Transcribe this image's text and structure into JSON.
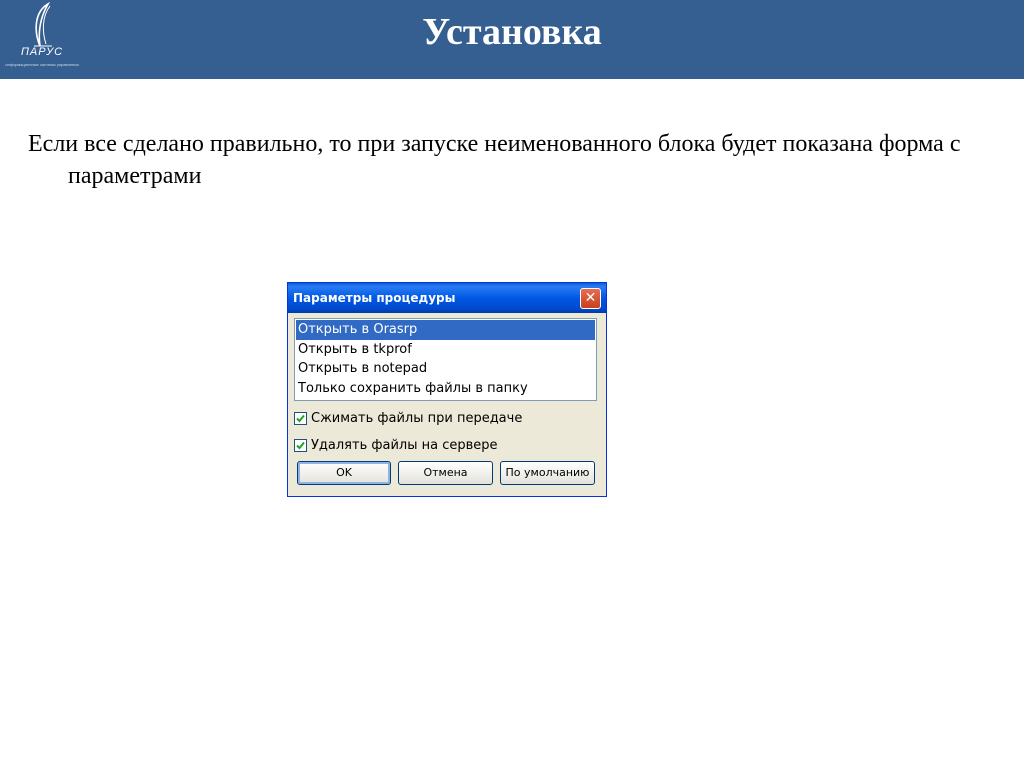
{
  "header": {
    "title": "Установка",
    "logo": {
      "word": "ПАРУС",
      "tagline": "информационные системы управления"
    }
  },
  "body": {
    "text": "Если все сделано правильно, то при запуске неименованного блока будет показана форма с параметрами"
  },
  "dialog": {
    "title": "Параметры процедуры",
    "close_glyph": "✕",
    "list": {
      "items": [
        "Открыть в Orasrp",
        "Открыть в tkprof",
        "Открыть в notepad",
        "Только сохранить файлы в папку"
      ],
      "selected_index": 0
    },
    "checkboxes": {
      "compress": {
        "label": "Сжимать файлы при передаче",
        "checked": true
      },
      "delete": {
        "label": "Удалять файлы на сервере",
        "checked": true
      }
    },
    "buttons": {
      "ok": "OK",
      "cancel": "Отмена",
      "defaults": "По умолчанию"
    }
  },
  "colors": {
    "header_bg": "#365f91",
    "dialog_bg": "#ece9d8",
    "titlebar": "#0058e6",
    "selection": "#316ac5"
  }
}
